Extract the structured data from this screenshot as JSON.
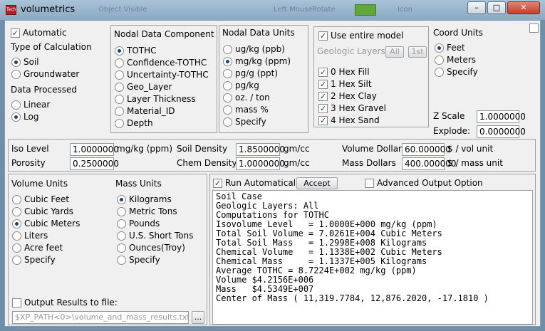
{
  "window": {
    "title": "volumetrics",
    "app_icon_text": "Tech",
    "ghost_tabs": [
      "Object Visible",
      "Left Mouse",
      "Rotate",
      "Icon"
    ]
  },
  "calc": {
    "automatic_label": "Automatic",
    "type_heading": "Type of Calculation",
    "type_options": [
      "Soil",
      "Groundwater"
    ],
    "data_heading": "Data Processed",
    "data_options": [
      "Linear",
      "Log"
    ]
  },
  "component": {
    "heading": "Nodal Data Component",
    "options": [
      "TOTHC",
      "Confidence-TOTHC",
      "Uncertainty-TOTHC",
      "Geo_Layer",
      "Layer Thickness",
      "Material_ID",
      "Depth"
    ]
  },
  "units": {
    "heading": "Nodal Data Units",
    "options": [
      "ug/kg (ppb)",
      "mg/kg (ppm)",
      "pg/g (ppt)",
      "pg/kg",
      "oz. / ton",
      "mass %",
      "Specify"
    ]
  },
  "model": {
    "use_entire_label": "Use entire model",
    "geo_layers_label": "Geologic Layers",
    "all_button": "All",
    "first_button": "1st",
    "layers": [
      "0 Hex Fill",
      "1 Hex Silt",
      "2 Hex Clay",
      "3 Hex Gravel",
      "4 Hex Sand"
    ]
  },
  "coord": {
    "heading": "Coord Units",
    "options": [
      "Feet",
      "Meters",
      "Specify"
    ],
    "z_scale_label": "Z Scale",
    "z_scale_value": "1.0000000",
    "explode_label": "Explode:",
    "explode_value": "0.0000000"
  },
  "params": {
    "iso_label": "Iso Level",
    "iso_value": "1.0000000",
    "iso_unit": "mg/kg (ppm)",
    "porosity_label": "Porosity",
    "porosity_value": "0.2500000",
    "soil_density_label": "Soil Density",
    "soil_density_value": "1.8500000",
    "soil_density_unit": "gm/cc",
    "chem_density_label": "Chem Density",
    "chem_density_value": "1.0000000",
    "chem_density_unit": "gm/cc",
    "vol_dollars_label": "Volume Dollars",
    "vol_dollars_value": "60.000000",
    "vol_dollars_unit": "$ / vol unit",
    "mass_dollars_label": "Mass Dollars",
    "mass_dollars_value": "400.000000",
    "mass_dollars_unit": "$ / mass unit"
  },
  "volume_units": {
    "heading": "Volume Units",
    "options": [
      "Cubic Feet",
      "Cubic Yards",
      "Cubic Meters",
      "Liters",
      "Acre feet",
      "Specify"
    ]
  },
  "mass_units": {
    "heading": "Mass Units",
    "options": [
      "Kilograms",
      "Metric Tons",
      "Pounds",
      "U.S. Short Tons",
      "Ounces(Troy)",
      "Specify"
    ]
  },
  "output_file": {
    "label": "Output Results to file:",
    "path": "$XP_PATH<0>\\volume_and_mass_results.txt",
    "browse": "..."
  },
  "run": {
    "run_auto_label": "Run Automatical",
    "accept_button": "Accept",
    "advanced_label": "Advanced Output Option"
  },
  "results": [
    "Soil Case",
    "Geologic Layers: All",
    "Computations for TOTHC",
    "Isovolume Level   = 1.0000E+000 mg/kg (ppm)",
    "Total Soil Volume = 7.0261E+004 Cubic Meters",
    "Total Soil Mass   = 1.2998E+008 Kilograms",
    "Chemical Volume   = 1.1338E+002 Cubic Meters",
    "Chemical Mass     = 1.1337E+005 Kilograms",
    "Average TOTHC = 8.7224E+002 mg/kg (ppm)",
    "Volume $4.2156E+006",
    "Mass   $4.5349E+007",
    "Center of Mass ( 11,319.7784, 12,876.2020, -17.1810 )"
  ]
}
